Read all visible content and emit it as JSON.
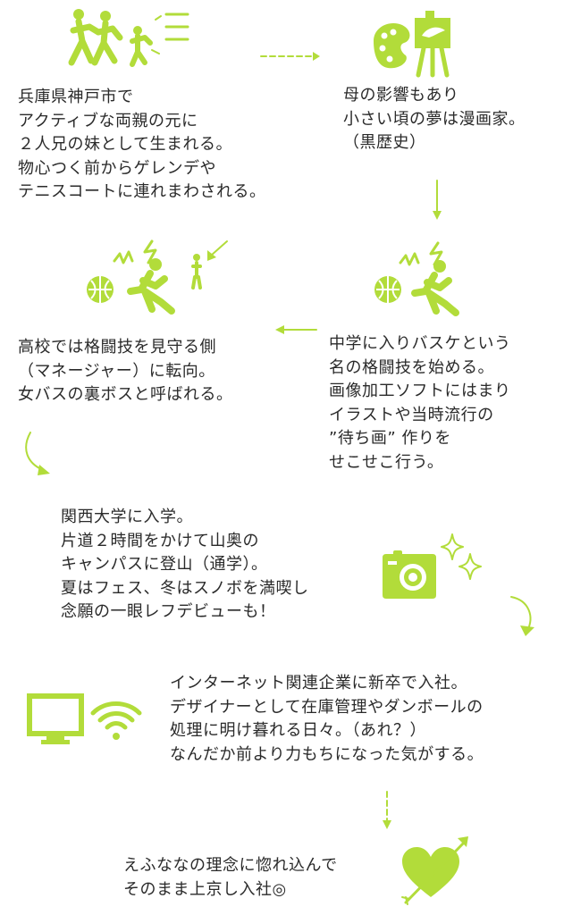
{
  "accent_color": "#b2dc3a",
  "text_color": "#2a2a2a",
  "sections": [
    {
      "id": "birth",
      "icon": "family-running-icon",
      "lines": [
        "兵庫県神戸市で",
        "アクティブな両親の元に",
        "２人兄の妹として生まれる。",
        "物心つく前からゲレンデや",
        "テニスコートに連れまわされる。"
      ]
    },
    {
      "id": "childhood",
      "icon": "palette-easel-icon",
      "lines": [
        "母の影響もあり",
        "小さい頃の夢は漫画家。",
        "（黒歴史）"
      ]
    },
    {
      "id": "middle-school",
      "icon": "basketball-icon",
      "lines": [
        "中学に入りバスケという",
        "名の格闘技を始める。",
        "画像加工ソフトにはまり",
        "イラストや当時流行の",
        "”待ち画” 作りを",
        "せこせこ行う。"
      ]
    },
    {
      "id": "high-school",
      "icon": "basketball-manager-icon",
      "lines": [
        "高校では格闘技を見守る側",
        "（マネージャー）に転向。",
        "女バスの裏ボスと呼ばれる。"
      ]
    },
    {
      "id": "university",
      "icon": "camera-sparkle-icon",
      "lines": [
        "関西大学に入学。",
        "片道２時間をかけて山奥の",
        "キャンパスに登山（通学）。",
        "夏はフェス、冬はスノボを満喫し",
        "念願の一眼レフデビューも！"
      ]
    },
    {
      "id": "first-job",
      "icon": "monitor-wifi-icon",
      "lines": [
        "インターネット関連企業に新卒で入社。",
        "デザイナーとして在庫管理やダンボールの",
        "処理に明け暮れる日々。（あれ？）",
        "なんだか前より力もちになった気がする。"
      ]
    },
    {
      "id": "current",
      "icon": "heart-arrow-icon",
      "lines": [
        "えふななの理念に惚れ込んで",
        "そのまま上京し入社◎"
      ]
    }
  ]
}
